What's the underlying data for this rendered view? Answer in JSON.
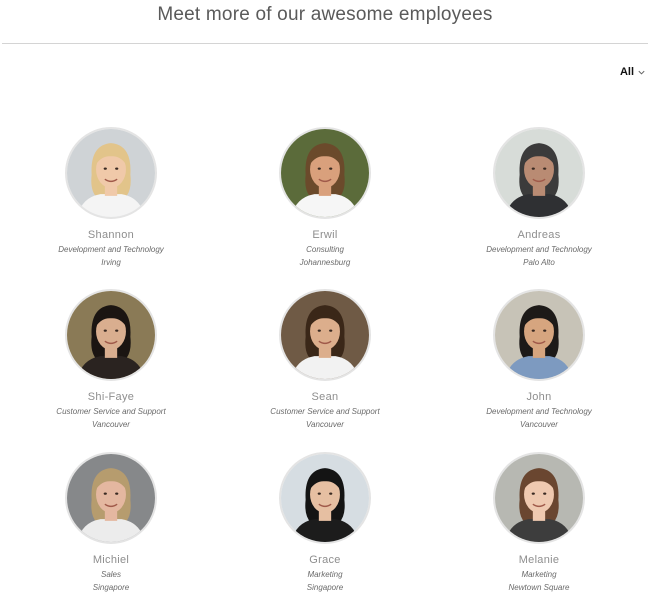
{
  "header": {
    "title": "Meet more of our awesome employees"
  },
  "filter": {
    "label": "All",
    "icon": "chevron-down-icon"
  },
  "employees": [
    {
      "name": "Shannon",
      "department": "Development and Technology",
      "location": "Irving",
      "photo": {
        "bg": "#cfd3d6",
        "hair": "#e2c48a",
        "skin": "#f0c9a9",
        "shirt": "#f4f4f4"
      }
    },
    {
      "name": "Erwil",
      "department": "Consulting",
      "location": "Johannesburg",
      "photo": {
        "bg": "#5b6b3a",
        "hair": "#6b4a2b",
        "skin": "#d9a07c",
        "shirt": "#f6f6f6"
      }
    },
    {
      "name": "Andreas",
      "department": "Development and Technology",
      "location": "Palo Alto",
      "photo": {
        "bg": "#d7dcd8",
        "hair": "#3b3b3b",
        "skin": "#b98b73",
        "shirt": "#2f3033"
      }
    },
    {
      "name": "Shi-Faye",
      "department": "Customer Service and Support",
      "location": "Vancouver",
      "photo": {
        "bg": "#8a7a56",
        "hair": "#1b1512",
        "skin": "#d9ae8f",
        "shirt": "#2a2320"
      }
    },
    {
      "name": "Sean",
      "department": "Customer Service and Support",
      "location": "Vancouver",
      "photo": {
        "bg": "#6f5a45",
        "hair": "#3a2718",
        "skin": "#dcae8c",
        "shirt": "#f2f2f2"
      }
    },
    {
      "name": "John",
      "department": "Development and Technology",
      "location": "Vancouver",
      "photo": {
        "bg": "#c7c3b7",
        "hair": "#1d1a18",
        "skin": "#d6a57f",
        "shirt": "#7d9ac0"
      }
    },
    {
      "name": "Michiel",
      "department": "Sales",
      "location": "Singapore",
      "photo": {
        "bg": "#86888a",
        "hair": "#b69c6e",
        "skin": "#e4b7a0",
        "shirt": "#ececec"
      }
    },
    {
      "name": "Grace",
      "department": "Marketing",
      "location": "Singapore",
      "photo": {
        "bg": "#d6dde2",
        "hair": "#141414",
        "skin": "#e6bfa2",
        "shirt": "#1c1c1c"
      }
    },
    {
      "name": "Melanie",
      "department": "Marketing",
      "location": "Newtown Square",
      "photo": {
        "bg": "#b7b8b2",
        "hair": "#6a4630",
        "skin": "#efc9b0",
        "shirt": "#3d3d3d"
      }
    }
  ]
}
